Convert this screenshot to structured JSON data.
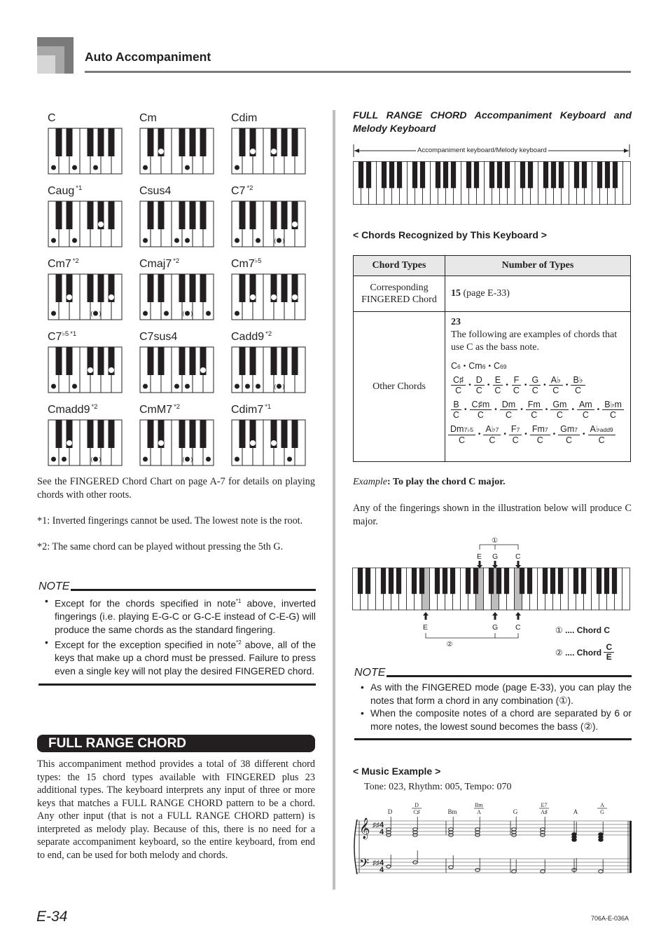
{
  "header": {
    "section_title": "Auto Accompaniment"
  },
  "chord_chart": {
    "chords": [
      {
        "name": "C",
        "note": "",
        "keys": [
          {
            "k": "w0",
            "t": "dot"
          },
          {
            "k": "w2",
            "t": "dot"
          },
          {
            "k": "w4",
            "t": "dot"
          }
        ]
      },
      {
        "name": "Cm",
        "note": "",
        "keys": [
          {
            "k": "w0",
            "t": "dot"
          },
          {
            "k": "b1",
            "t": "ring"
          },
          {
            "k": "w4",
            "t": "dot"
          }
        ]
      },
      {
        "name": "Cdim",
        "note": "",
        "keys": [
          {
            "k": "w0",
            "t": "dot"
          },
          {
            "k": "b1",
            "t": "ring"
          },
          {
            "k": "b3",
            "t": "ring"
          }
        ]
      },
      {
        "name": "Caug",
        "note": "*1",
        "keys": [
          {
            "k": "w0",
            "t": "dot"
          },
          {
            "k": "w2",
            "t": "dot"
          },
          {
            "k": "b4",
            "t": "ring"
          }
        ]
      },
      {
        "name": "Csus4",
        "note": "",
        "keys": [
          {
            "k": "w0",
            "t": "dot"
          },
          {
            "k": "w3",
            "t": "dot"
          },
          {
            "k": "w4",
            "t": "dot"
          }
        ]
      },
      {
        "name": "C7",
        "note": "*2",
        "keys": [
          {
            "k": "w0",
            "t": "dot"
          },
          {
            "k": "w2",
            "t": "dot"
          },
          {
            "k": "w4",
            "t": "paren"
          },
          {
            "k": "b5",
            "t": "ring"
          }
        ]
      },
      {
        "name": "Cm7",
        "note": "*2",
        "keys": [
          {
            "k": "w0",
            "t": "dot"
          },
          {
            "k": "b1",
            "t": "ring"
          },
          {
            "k": "w4",
            "t": "paren"
          },
          {
            "k": "b5",
            "t": "ring"
          }
        ]
      },
      {
        "name": "Cmaj7",
        "note": "*2",
        "keys": [
          {
            "k": "w0",
            "t": "dot"
          },
          {
            "k": "w2",
            "t": "dot"
          },
          {
            "k": "w4",
            "t": "paren"
          },
          {
            "k": "w6",
            "t": "dot"
          }
        ]
      },
      {
        "name": "Cm7",
        "flat5": "♭5",
        "note": "",
        "keys": [
          {
            "k": "w0",
            "t": "dot"
          },
          {
            "k": "b1",
            "t": "ring"
          },
          {
            "k": "b3",
            "t": "ring"
          },
          {
            "k": "b5",
            "t": "ring"
          }
        ]
      },
      {
        "name": "C7",
        "flat5": "♭5",
        "note": "*1",
        "keys": [
          {
            "k": "w0",
            "t": "dot"
          },
          {
            "k": "w2",
            "t": "dot"
          },
          {
            "k": "b3",
            "t": "ring"
          },
          {
            "k": "b5",
            "t": "ring"
          }
        ]
      },
      {
        "name": "C7sus4",
        "note": "",
        "keys": [
          {
            "k": "w0",
            "t": "dot"
          },
          {
            "k": "w3",
            "t": "dot"
          },
          {
            "k": "w4",
            "t": "dot"
          },
          {
            "k": "b5",
            "t": "ring"
          }
        ]
      },
      {
        "name": "Cadd9",
        "note": "*2",
        "keys": [
          {
            "k": "w0",
            "t": "dot"
          },
          {
            "k": "w1",
            "t": "dot"
          },
          {
            "k": "w2",
            "t": "dot"
          },
          {
            "k": "w4",
            "t": "paren"
          }
        ]
      },
      {
        "name": "Cmadd9",
        "note": "*2",
        "keys": [
          {
            "k": "w0",
            "t": "dot"
          },
          {
            "k": "w1",
            "t": "dot"
          },
          {
            "k": "b1",
            "t": "ring"
          },
          {
            "k": "w4",
            "t": "paren"
          }
        ]
      },
      {
        "name": "CmM7",
        "note": "*2",
        "keys": [
          {
            "k": "w0",
            "t": "dot"
          },
          {
            "k": "b1",
            "t": "ring"
          },
          {
            "k": "w4",
            "t": "paren"
          },
          {
            "k": "w6",
            "t": "dot"
          }
        ]
      },
      {
        "name": "Cdim7",
        "note": "*1",
        "keys": [
          {
            "k": "w0",
            "t": "dot"
          },
          {
            "k": "b1",
            "t": "ring"
          },
          {
            "k": "b3",
            "t": "ring"
          },
          {
            "k": "w5",
            "t": "dot"
          }
        ]
      }
    ]
  },
  "left": {
    "see_chart": "See the FINGERED Chord Chart on page A-7 for details on playing chords with other roots.",
    "footnote1": "*1: Inverted fingerings cannot be used. The lowest note is the root.",
    "footnote2": "*2: The same chord can be played without pressing the 5th G.",
    "note_heading": "NOTE",
    "note1_a": "Except for the chords specified in note",
    "note1_sup": "*1",
    "note1_b": " above, inverted fingerings (i.e. playing E-G-C or G-C-E instead of C-E-G) will produce the same chords as the standard fingering.",
    "note2_a": "Except for the exception specified in note",
    "note2_sup": "*2",
    "note2_b": " above, all of the keys that make up a chord must be pressed. Failure to press even a single key will not play the desired FINGERED chord.",
    "section_banner": "FULL RANGE CHORD",
    "frc_paragraph": "This accompaniment method provides a total of 38 different chord types: the 15 chord types available with FINGERED plus 23 additional types. The keyboard interprets any input of three or more keys that matches a FULL RANGE CHORD pattern to be a chord. Any other input (that is not a FULL RANGE CHORD pattern) is interpreted as melody play. Because of this, there is no need for a separate accompaniment keyboard, so the entire keyboard, from end to end, can be used for both melody and chords."
  },
  "right": {
    "kb_title": "FULL RANGE CHORD Accompaniment Keyboard and Melody Keyboard",
    "kb_caption": "Accompaniment keyboard/Melody keyboard",
    "kb_white_keys": 36,
    "chords_heading": "< Chords Recognized by This Keyboard >",
    "table": {
      "headers": [
        "Chord Types",
        "Number of Types"
      ],
      "row1": {
        "type": "Corresponding FINGERED Chord",
        "count": "15",
        "ref": " (page E-33)"
      },
      "row2": {
        "type": "Other Chords",
        "count": "23",
        "desc": "The following are examples of chords that use C as the bass note.",
        "simple": [
          {
            "b": "C",
            "s": "6"
          },
          {
            "b": "Cm",
            "s": "6"
          },
          {
            "b": "C",
            "s": "69"
          }
        ],
        "fr1": [
          {
            "n": "C♯",
            "d": "C"
          },
          {
            "n": "D",
            "d": "C"
          },
          {
            "n": "E",
            "d": "C"
          },
          {
            "n": "F",
            "d": "C"
          },
          {
            "n": "G",
            "d": "C"
          },
          {
            "n": "A♭",
            "d": "C"
          },
          {
            "n": "B♭",
            "d": "C"
          }
        ],
        "fr2": [
          {
            "n": "B",
            "d": "C"
          },
          {
            "n": "C♯m",
            "d": "C"
          },
          {
            "n": "Dm",
            "d": "C"
          },
          {
            "n": "Fm",
            "d": "C"
          },
          {
            "n": "Gm",
            "d": "C"
          },
          {
            "n": "Am",
            "d": "C"
          },
          {
            "n": "B♭m",
            "d": "C"
          }
        ],
        "fr3": [
          {
            "n": "Dm",
            "s": "7♭5",
            "d": "C"
          },
          {
            "n": "A♭",
            "s": "7",
            "d": "C"
          },
          {
            "n": "F",
            "s": "7",
            "d": "C"
          },
          {
            "n": "Fm",
            "s": "7",
            "d": "C"
          },
          {
            "n": "Gm",
            "s": "7",
            "d": "C"
          },
          {
            "n": "A♭",
            "s": "add9",
            "d": "C"
          }
        ]
      }
    },
    "example_label": "Example",
    "example_title": ": To play the chord C major.",
    "example_text": "Any of the fingerings shown in the illustration below will produce C major.",
    "cmaj": {
      "top_marker": "①",
      "top_notes": [
        "E",
        "G",
        "C"
      ],
      "bottom_notes": [
        "E",
        "G",
        "C"
      ],
      "bottom_marker": "②",
      "highlighted_white_keys": [
        9,
        16,
        18,
        21
      ]
    },
    "legend1": {
      "marker": "①",
      "text": " .... Chord C"
    },
    "legend2": {
      "marker": "②",
      "text": " .... Chord ",
      "num": "C",
      "den": "E"
    },
    "note_heading": "NOTE",
    "note1": "As with the FINGERED mode (page E-33), you can play the notes that form a chord in any combination (①).",
    "note2": "When the composite notes of a chord are separated by 6 or more notes, the lowest sound becomes the bass (②).",
    "music_heading": "< Music Example >",
    "music_settings": "Tone: 023, Rhythm: 005, Tempo: 070",
    "music_chords": [
      {
        "n": "D",
        "d": ""
      },
      {
        "n": "D",
        "d": "C♯"
      },
      {
        "n": "Bm",
        "d": ""
      },
      {
        "n": "Bm",
        "d": "A"
      },
      {
        "n": "G",
        "d": ""
      },
      {
        "n": "E7",
        "d": "A♯"
      },
      {
        "n": "A",
        "d": ""
      },
      {
        "n": "A",
        "d": "G"
      }
    ]
  },
  "footer": {
    "page_number": "E-34",
    "doc_code": "706A-E-036A"
  }
}
